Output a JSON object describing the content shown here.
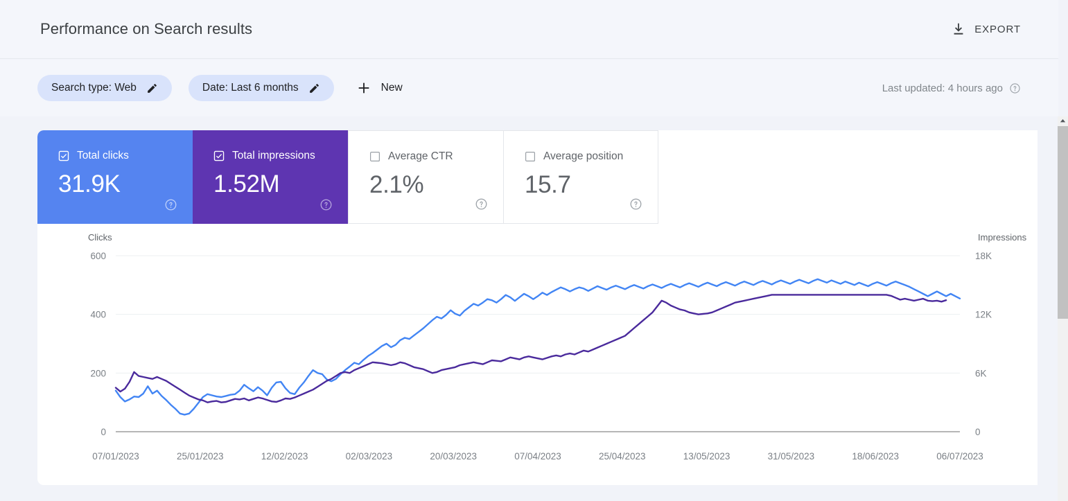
{
  "header": {
    "title": "Performance on Search results",
    "export_label": "EXPORT",
    "export_icon": "download-icon"
  },
  "filters": {
    "chips": [
      {
        "label": "Search type: Web",
        "icon": "pencil-icon"
      },
      {
        "label": "Date: Last 6 months",
        "icon": "pencil-icon"
      }
    ],
    "new_label": "New",
    "new_icon": "plus-icon",
    "last_updated": "Last updated: 4 hours ago",
    "help_icon": "help-circle-icon"
  },
  "metrics": [
    {
      "label": "Total clicks",
      "value": "31.9K",
      "checked": true,
      "color": "#5584f0",
      "help_icon": "help-circle-icon"
    },
    {
      "label": "Total impressions",
      "value": "1.52M",
      "checked": true,
      "color": "#5e35b1",
      "help_icon": "help-circle-icon"
    },
    {
      "label": "Average CTR",
      "value": "2.1%",
      "checked": false,
      "color": "#ffffff",
      "help_icon": "help-circle-icon"
    },
    {
      "label": "Average position",
      "value": "15.7",
      "checked": false,
      "color": "#ffffff",
      "help_icon": "help-circle-icon"
    }
  ],
  "chart_data": {
    "type": "line",
    "title": "",
    "xlabel": "",
    "grid": true,
    "legend_position": "none",
    "ylabel_left": "Clicks",
    "ylabel_right": "Impressions",
    "ylim_left": [
      0,
      600
    ],
    "yticks_left": [
      0,
      200,
      400,
      600
    ],
    "yticklabels_left": [
      "0",
      "200",
      "400",
      "600"
    ],
    "ylim_right": [
      0,
      18000
    ],
    "yticks_right": [
      0,
      6000,
      12000,
      18000
    ],
    "yticklabels_right": [
      "0",
      "6K",
      "12K",
      "18K"
    ],
    "xticklabels": [
      "07/01/2023",
      "25/01/2023",
      "12/02/2023",
      "02/03/2023",
      "20/03/2023",
      "07/04/2023",
      "25/04/2023",
      "13/05/2023",
      "31/05/2023",
      "18/06/2023",
      "06/07/2023"
    ],
    "xtick_positions": [
      0,
      18,
      36,
      54,
      72,
      90,
      108,
      126,
      144,
      162,
      180
    ],
    "series": [
      {
        "name": "Total clicks",
        "color": "#4285f4",
        "axis": "left",
        "values": [
          140,
          118,
          103,
          110,
          120,
          118,
          130,
          155,
          130,
          140,
          122,
          108,
          92,
          78,
          62,
          58,
          62,
          78,
          98,
          118,
          128,
          124,
          120,
          118,
          122,
          126,
          128,
          140,
          160,
          148,
          138,
          152,
          140,
          124,
          150,
          168,
          170,
          148,
          132,
          128,
          150,
          168,
          190,
          210,
          200,
          196,
          178,
          172,
          180,
          196,
          210,
          222,
          235,
          230,
          245,
          258,
          268,
          280,
          292,
          300,
          288,
          296,
          312,
          320,
          316,
          328,
          340,
          352,
          366,
          380,
          392,
          386,
          398,
          414,
          402,
          396,
          412,
          424,
          436,
          430,
          440,
          452,
          448,
          440,
          452,
          466,
          458,
          446,
          458,
          470,
          462,
          452,
          462,
          474,
          466,
          476,
          484,
          492,
          486,
          478,
          486,
          492,
          488,
          480,
          488,
          496,
          490,
          484,
          492,
          498,
          492,
          486,
          494,
          500,
          494,
          488,
          496,
          502,
          496,
          490,
          498,
          504,
          498,
          492,
          500,
          506,
          500,
          494,
          502,
          508,
          502,
          496,
          504,
          510,
          504,
          498,
          506,
          512,
          506,
          500,
          508,
          514,
          508,
          502,
          510,
          516,
          510,
          504,
          512,
          518,
          512,
          506,
          514,
          520,
          514,
          508,
          516,
          510,
          504,
          512,
          506,
          500,
          508,
          502,
          496,
          504,
          510,
          504,
          498,
          506,
          512,
          506,
          500,
          494,
          486,
          478,
          470,
          462,
          470,
          478,
          470,
          462,
          470,
          462,
          454
        ]
      },
      {
        "name": "Total impressions",
        "color": "#4a2a9c",
        "axis": "right",
        "values": [
          4500,
          4100,
          4400,
          5100,
          6100,
          5700,
          5600,
          5500,
          5400,
          5600,
          5400,
          5200,
          4900,
          4600,
          4300,
          4000,
          3700,
          3500,
          3300,
          3200,
          3000,
          3100,
          3150,
          3000,
          3050,
          3200,
          3350,
          3300,
          3400,
          3200,
          3350,
          3500,
          3400,
          3250,
          3100,
          3050,
          3200,
          3400,
          3350,
          3500,
          3700,
          3900,
          4100,
          4300,
          4600,
          4900,
          5200,
          5400,
          5700,
          6000,
          6100,
          6000,
          6300,
          6500,
          6700,
          6900,
          7100,
          7050,
          7000,
          6900,
          6800,
          6900,
          7100,
          7000,
          6800,
          6600,
          6500,
          6400,
          6200,
          6000,
          6100,
          6300,
          6400,
          6500,
          6600,
          6800,
          6900,
          7000,
          7100,
          7000,
          6900,
          7100,
          7300,
          7250,
          7200,
          7400,
          7600,
          7500,
          7400,
          7600,
          7700,
          7600,
          7500,
          7400,
          7550,
          7700,
          7800,
          7700,
          7900,
          8000,
          7900,
          8100,
          8300,
          8200,
          8400,
          8600,
          8800,
          9000,
          9200,
          9400,
          9600,
          9800,
          10200,
          10600,
          11000,
          11400,
          11800,
          12200,
          12800,
          13400,
          13200,
          12900,
          12700,
          12500,
          12400,
          12200,
          12100,
          12000,
          12050,
          12100,
          12200,
          12400,
          12600,
          12800,
          13000,
          13200,
          13300,
          13400,
          13500,
          13600,
          13700,
          13800,
          13900,
          14000,
          14000,
          14000,
          14000,
          14000,
          14000,
          14000,
          14000,
          14000,
          14000,
          14000,
          14000,
          14000,
          14000,
          14000,
          14000,
          14000,
          14000,
          14000,
          14000,
          14000,
          14000,
          14000,
          14000,
          14000,
          14000,
          13900,
          13700,
          13500,
          13600,
          13500,
          13400,
          13500,
          13600,
          13400,
          13350,
          13400,
          13300,
          13450
        ]
      }
    ]
  },
  "scrollbar": {
    "up_arrow_icon": "chevron-up-icon"
  }
}
